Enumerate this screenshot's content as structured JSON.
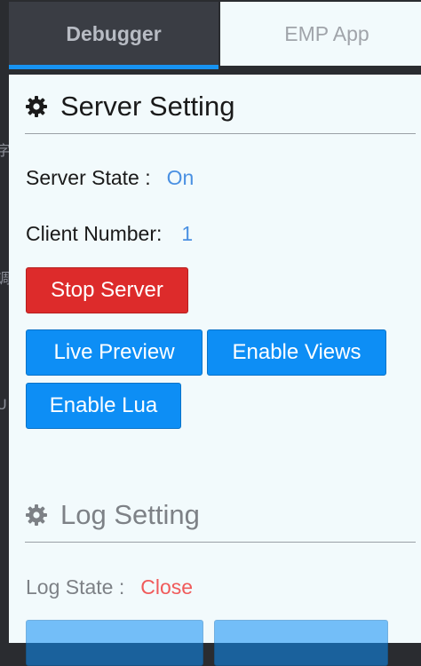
{
  "tabs": [
    {
      "label": "Debugger",
      "active": true
    },
    {
      "label": "EMP App",
      "active": false
    }
  ],
  "server_section": {
    "title": "Server Setting",
    "icon": "gear-icon",
    "state_label": "Server State :",
    "state_value": "On",
    "client_label": "Client Number:",
    "client_value": "1",
    "buttons": {
      "stop_server": "Stop Server",
      "live_preview": "Live Preview",
      "enable_views": "Enable Views",
      "enable_lua": "Enable Lua"
    }
  },
  "log_section": {
    "title": "Log Setting",
    "icon": "gear-icon",
    "state_label": "Log State :",
    "state_value": "Close"
  },
  "colors": {
    "accent_blue": "#0d8ef5",
    "danger_red": "#dd2b2b",
    "on_text": "#4a90e2",
    "close_text": "#f05a5a",
    "tab_underline": "#1793f2"
  }
}
